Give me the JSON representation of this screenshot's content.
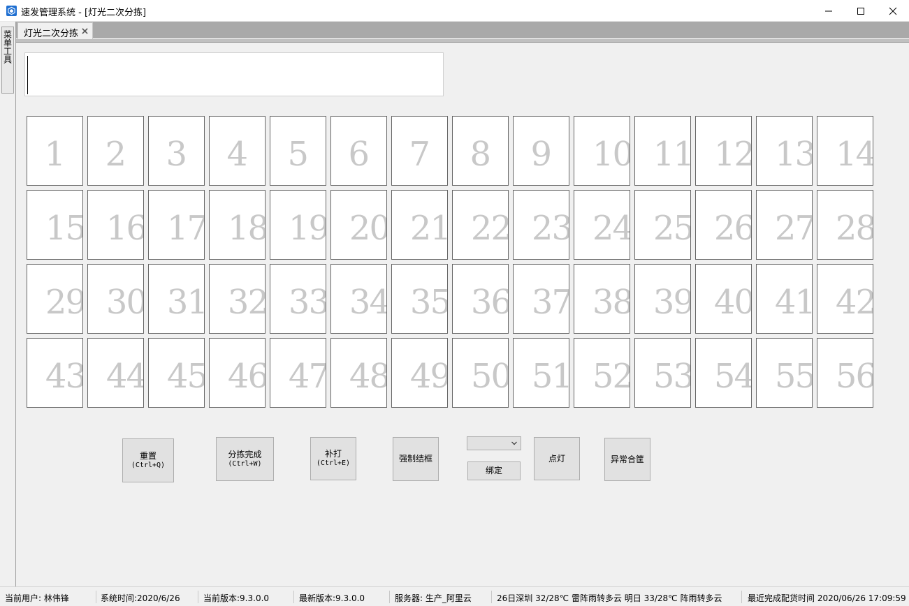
{
  "window": {
    "title": "速发管理系统 - [灯光二次分拣]",
    "app_icon": "cube-icon",
    "controls": [
      "minimize-icon",
      "maximize-icon",
      "close-icon"
    ]
  },
  "side_tabs": [
    {
      "label": "菜单工具"
    }
  ],
  "doc_tabs": [
    {
      "label": "灯光二次分拣",
      "active": true
    }
  ],
  "scan_input": {
    "value": ""
  },
  "grid": {
    "cells": [
      "1",
      "2",
      "3",
      "4",
      "5",
      "6",
      "7",
      "8",
      "9",
      "10",
      "11",
      "12",
      "13",
      "14",
      "15",
      "16",
      "17",
      "18",
      "19",
      "20",
      "21",
      "22",
      "23",
      "24",
      "25",
      "26",
      "27",
      "28",
      "29",
      "30",
      "31",
      "32",
      "33",
      "34",
      "35",
      "36",
      "37",
      "38",
      "39",
      "40",
      "41",
      "42",
      "43",
      "44",
      "45",
      "46",
      "47",
      "48",
      "49",
      "50",
      "51",
      "52",
      "53",
      "54",
      "55",
      "56"
    ]
  },
  "actions": {
    "reset": {
      "label": "重置",
      "shortcut": "(Ctrl+Q)"
    },
    "sort_complete": {
      "label": "分拣完成",
      "shortcut": "(Ctrl+W)"
    },
    "reprint": {
      "label": "补打",
      "shortcut": "(Ctrl+E)"
    },
    "force_close": {
      "label": "强制结框"
    },
    "bind_select": {
      "value": ""
    },
    "bind": {
      "label": "绑定"
    },
    "light": {
      "label": "点灯"
    },
    "exception_box": {
      "label": "异常合筐"
    }
  },
  "status": {
    "user": "当前用户: 林伟锋",
    "system_time": "系统时间:2020/6/26",
    "current_version": "当前版本:9.3.0.0",
    "latest_version": "最新版本:9.3.0.0",
    "server": "服务器:  生产_阿里云",
    "weather": "26日深圳 32/28℃ 雷阵雨转多云 明日 33/28℃ 阵雨转多云",
    "last_delivery": "最近完成配货时间 2020/06/26 17:09:59"
  },
  "colors": {
    "title_bar": "#ffffff",
    "tab_header": "#a9a9a9",
    "cell_number": "#c8c8c8",
    "app_icon": "#1f6fd1"
  }
}
